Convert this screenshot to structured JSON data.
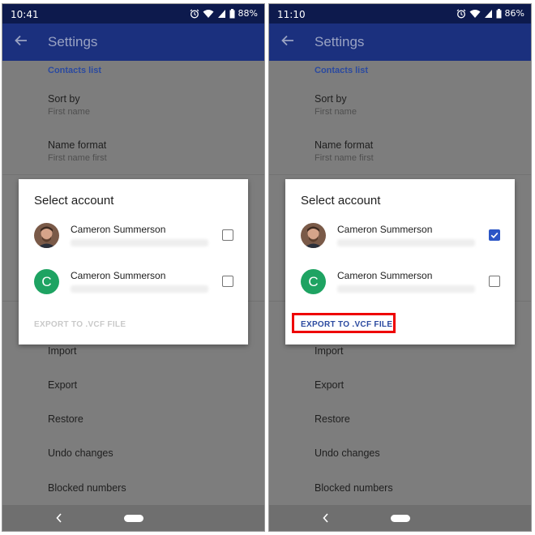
{
  "screens": [
    {
      "status": {
        "time": "10:41",
        "battery": "88%"
      },
      "appbar": {
        "title": "Settings"
      },
      "section_header": "Contacts list",
      "prefs": [
        {
          "title": "Sort by",
          "summary": "First name"
        },
        {
          "title": "Name format",
          "summary": "First name first"
        }
      ],
      "menu_items": [
        "Import",
        "Export",
        "Restore",
        "Undo changes",
        "Blocked numbers"
      ],
      "dialog": {
        "title": "Select account",
        "accounts": [
          {
            "name": "Cameron Summerson",
            "avatar": "photo",
            "checked": false
          },
          {
            "name": "Cameron Summerson",
            "avatar": "C",
            "checked": false
          }
        ],
        "export_label": "EXPORT TO .VCF FILE",
        "export_enabled": false
      }
    },
    {
      "status": {
        "time": "11:10",
        "battery": "86%"
      },
      "appbar": {
        "title": "Settings"
      },
      "section_header": "Contacts list",
      "prefs": [
        {
          "title": "Sort by",
          "summary": "First name"
        },
        {
          "title": "Name format",
          "summary": "First name first"
        }
      ],
      "menu_items": [
        "Import",
        "Export",
        "Restore",
        "Undo changes",
        "Blocked numbers"
      ],
      "dialog": {
        "title": "Select account",
        "accounts": [
          {
            "name": "Cameron Summerson",
            "avatar": "photo",
            "checked": true
          },
          {
            "name": "Cameron Summerson",
            "avatar": "C",
            "checked": false
          }
        ],
        "export_label": "EXPORT TO .VCF FILE",
        "export_enabled": true
      }
    }
  ],
  "colors": {
    "appbar": "#1b307e",
    "statusbar": "#0d1a4d",
    "accent": "#2b4aa0",
    "checkbox_checked": "#2b55c6",
    "avatar_green": "#1ea362",
    "highlight": "#ee0000"
  },
  "icons": {
    "back": "arrow-back-icon",
    "alarm": "alarm-icon",
    "wifi": "wifi-icon",
    "signal": "signal-icon",
    "battery": "battery-icon",
    "check": "check-icon",
    "nav_back": "nav-back-icon",
    "nav_home": "nav-home-pill"
  }
}
